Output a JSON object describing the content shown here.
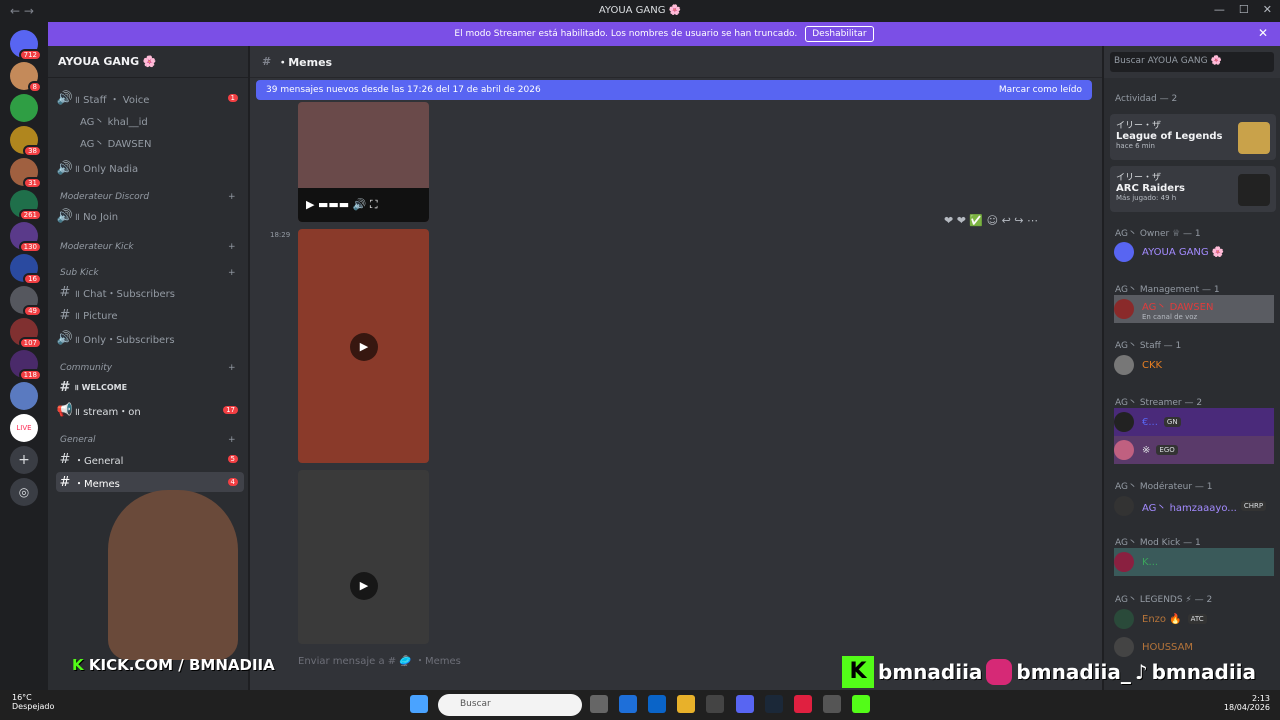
{
  "window": {
    "title": "AYOUA GANG 🌸"
  },
  "banner": {
    "text": "El modo Streamer está habilitado. Los nombres de usuario se han truncado.",
    "button": "Deshabilitar"
  },
  "servers": {
    "badges": [
      "712",
      "8",
      "38",
      "31",
      "261",
      "130",
      "16",
      "49",
      "107",
      "118"
    ],
    "live_label": "LIVE"
  },
  "sidebar": {
    "server_name": "AYOUA GANG 🌸",
    "items": [
      {
        "label": "॥ Staff ・ Voice",
        "badge": "1"
      },
      {
        "label": "AG丶 khal__id"
      },
      {
        "label": "AG丶 DAWSEN"
      },
      {
        "label": "॥ Only Nadia"
      },
      {
        "label": "Moderateur Discord"
      },
      {
        "label": "॥ No Join"
      },
      {
        "label": "Moderateur Kick"
      },
      {
        "label": "Sub Kick"
      },
      {
        "label": "॥ Chat・Subscribers"
      },
      {
        "label": "॥ Picture"
      },
      {
        "label": "॥ Only・Subscribers"
      },
      {
        "label": "Community"
      },
      {
        "label": "॥ WELCOME"
      },
      {
        "label": "॥ stream・on",
        "badge": "17"
      },
      {
        "label": "General"
      },
      {
        "label": "・General",
        "badge": "5"
      },
      {
        "label": "・Memes",
        "badge": "4"
      }
    ]
  },
  "chat": {
    "channel": "・Memes",
    "new_messages": "39 mensajes nuevos desde las 17:26 del 17 de abril de 2026",
    "mark_read": "Marcar como leído",
    "timestamp": "18:29",
    "compose_placeholder": "Enviar mensaje a # 🥏 ・Memes"
  },
  "members": {
    "search_placeholder": "Buscar AYOUA GANG 🌸",
    "activity_header": "Actividad — 2",
    "activities": [
      {
        "user": "イリー・ザ",
        "game": "League of Legends",
        "time": "hace 6 min"
      },
      {
        "user": "イリー・ザ",
        "game": "ARC Raiders",
        "time": "Más jugado: 49 h"
      }
    ],
    "groups": [
      {
        "header": "AG丶 Owner ♕ — 1",
        "members": [
          {
            "name": "AYOUA GANG 🌸",
            "color": "#a38bff"
          }
        ]
      },
      {
        "header": "AG丶 Management — 1",
        "members": [
          {
            "name": "AG丶 DAWSEN",
            "color": "#e03c3c",
            "status": "En canal de voz"
          }
        ]
      },
      {
        "header": "AG丶 Staff — 1",
        "members": [
          {
            "name": "CKK",
            "color": "#e67e22"
          }
        ]
      },
      {
        "header": "AG丶 Streamer — 2",
        "members": [
          {
            "name": "€...",
            "color": "#5865f2",
            "tag": "GN"
          },
          {
            "name": "※",
            "color": "#dbdee1",
            "tag": "EGO"
          }
        ]
      },
      {
        "header": "AG丶 Modérateur — 1",
        "members": [
          {
            "name": "AG丶 hamzaaayo...",
            "color": "#a38bff",
            "tag": "CHRP"
          }
        ]
      },
      {
        "header": "AG丶 Mod Kick — 1",
        "members": [
          {
            "name": "K...",
            "color": "#3ba55c"
          }
        ]
      },
      {
        "header": "AG丶 LEGENDS ⚡ — 2",
        "members": [
          {
            "name": "Enzo 🔥",
            "color": "#b5743a",
            "tag": "ATC"
          },
          {
            "name": "HOUSSAM",
            "color": "#b5743a"
          }
        ]
      }
    ]
  },
  "overlay": {
    "kick": "KICK.COM / BMNADIIA",
    "kick_handle": "bmnadiia",
    "instagram": "bmnadiia_",
    "tiktok": "bmnadiia"
  },
  "taskbar": {
    "temp": "16°C",
    "weather": "Despejado",
    "search": "Buscar",
    "time": "2:13",
    "date": "18/04/2026"
  }
}
